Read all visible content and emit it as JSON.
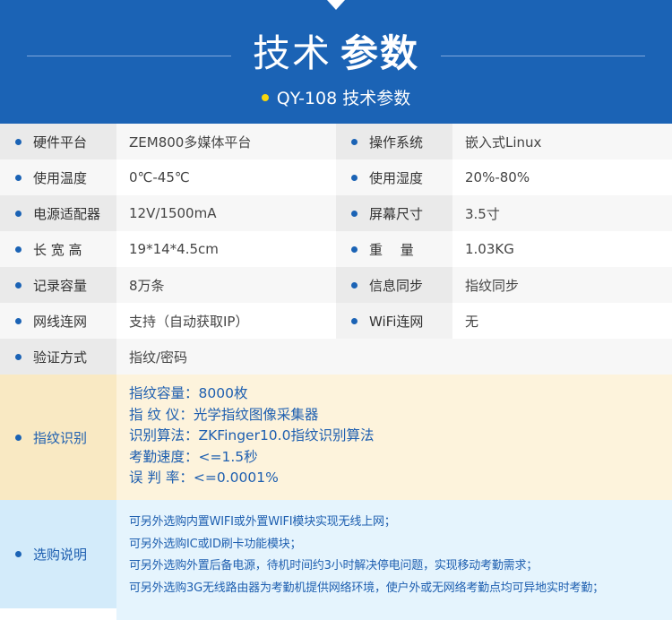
{
  "header": {
    "title_thin": "技术",
    "title_bold": "参数",
    "subtitle": "QY-108 技术参数",
    "colors": {
      "background": "#1b63b5",
      "accent_dot": "#f5d60e"
    }
  },
  "specs": [
    {
      "label_left": "硬件平台",
      "value_left": "ZEM800多媒体平台",
      "label_right": "操作系统",
      "value_right": "嵌入式Linux"
    },
    {
      "label_left": "使用温度",
      "value_left": "0℃-45℃",
      "label_right": "使用湿度",
      "value_right": "20%-80%"
    },
    {
      "label_left": "电源适配器",
      "value_left": "12V/1500mA",
      "label_right": "屏幕尺寸",
      "value_right": "3.5寸"
    },
    {
      "label_left": "长 宽 高",
      "value_left": "19*14*4.5cm",
      "label_right": "重　 量",
      "value_right": "1.03KG"
    },
    {
      "label_left": "记录容量",
      "value_left": "8万条",
      "label_right": "信息同步",
      "value_right": "指纹同步"
    },
    {
      "label_left": "网线连网",
      "value_left": "支持（自动获取IP）",
      "label_right": "WiFi连网",
      "value_right": "无"
    },
    {
      "label_left": "验证方式",
      "value_left": "指纹/密码"
    }
  ],
  "fingerprint": {
    "label": "指纹识别",
    "lines": [
      "指纹容量：8000枚",
      "指 纹 仪：光学指纹图像采集器",
      "识别算法：ZKFinger10.0指纹识别算法",
      "考勤速度：<=1.5秒",
      "误 判 率：<=0.0001%"
    ]
  },
  "purchase": {
    "label": "选购说明",
    "lines": [
      "可另外选购内置WIFI或外置WIFI模块实现无线上网；",
      "可另外选购IC或ID刷卡功能模块；",
      "可另外选购外置后备电源，待机时间约3小时解决停电问题，实现移动考勤需求；",
      "可另外选购3G无线路由器为考勤机提供网络环境，使户外或无网络考勤点均可异地实时考勤；"
    ]
  }
}
